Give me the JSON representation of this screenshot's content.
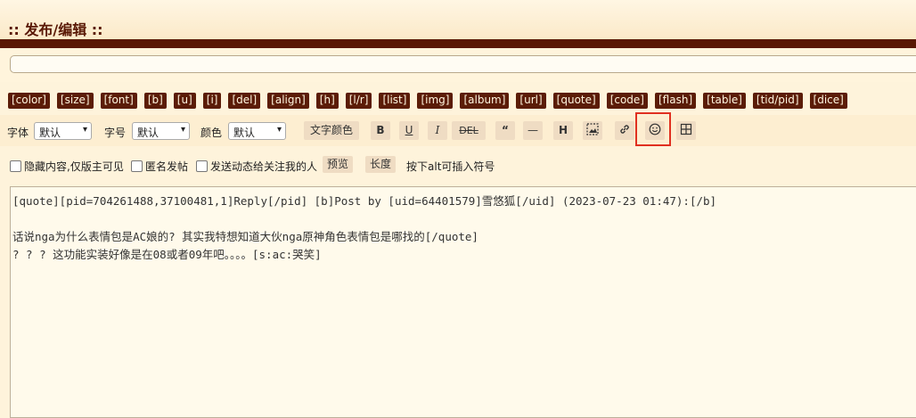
{
  "header": {
    "title": ":: 发布/编辑 ::"
  },
  "subject": {
    "value": ""
  },
  "tags": [
    "[color]",
    "[size]",
    "[font]",
    "[b]",
    "[u]",
    "[i]",
    "[del]",
    "[align]",
    "[h]",
    "[l/r]",
    "[list]",
    "[img]",
    "[album]",
    "[url]",
    "[quote]",
    "[code]",
    "[flash]",
    "[table]",
    "[tid/pid]",
    "[dice]"
  ],
  "toolbar": {
    "font_label": "字体",
    "font_value": "默认",
    "size_label": "字号",
    "size_value": "默认",
    "color_label": "颜色",
    "color_value": "默认",
    "text_color_button": "文字颜色",
    "bold": "B",
    "underline": "U",
    "italic": "I",
    "strike": "DEL",
    "quote": "“",
    "hr": "—",
    "heading": "H",
    "image_icon": "image-icon",
    "link_icon": "link-icon",
    "emoji_icon": "smiley-icon",
    "table_icon": "table-icon"
  },
  "options": {
    "hide_content": "隐藏内容,仅版主可见",
    "anonymous": "匿名发帖",
    "send_feed": "发送动态给关注我的人",
    "preview_button": "预览",
    "length_button": "长度",
    "hint": "按下alt可插入符号"
  },
  "editor": {
    "lines": [
      "[quote][pid=704261488,37100481,1]Reply[/pid] [b]Post by [uid=64401579]雪悠狐[/uid] (2023-07-23 01:47):[/b]",
      "",
      "话说nga为什么表情包是AC娘的? 其实我特想知道大伙nga原神角色表情包是哪找的[/quote]",
      "? ? ? 这功能实装好像是在08或者09年吧。。。。[s:ac:哭笑]"
    ]
  },
  "colors": {
    "brand": "#591804",
    "tag_bg": "#5b1c07",
    "highlight": "#e03020"
  }
}
